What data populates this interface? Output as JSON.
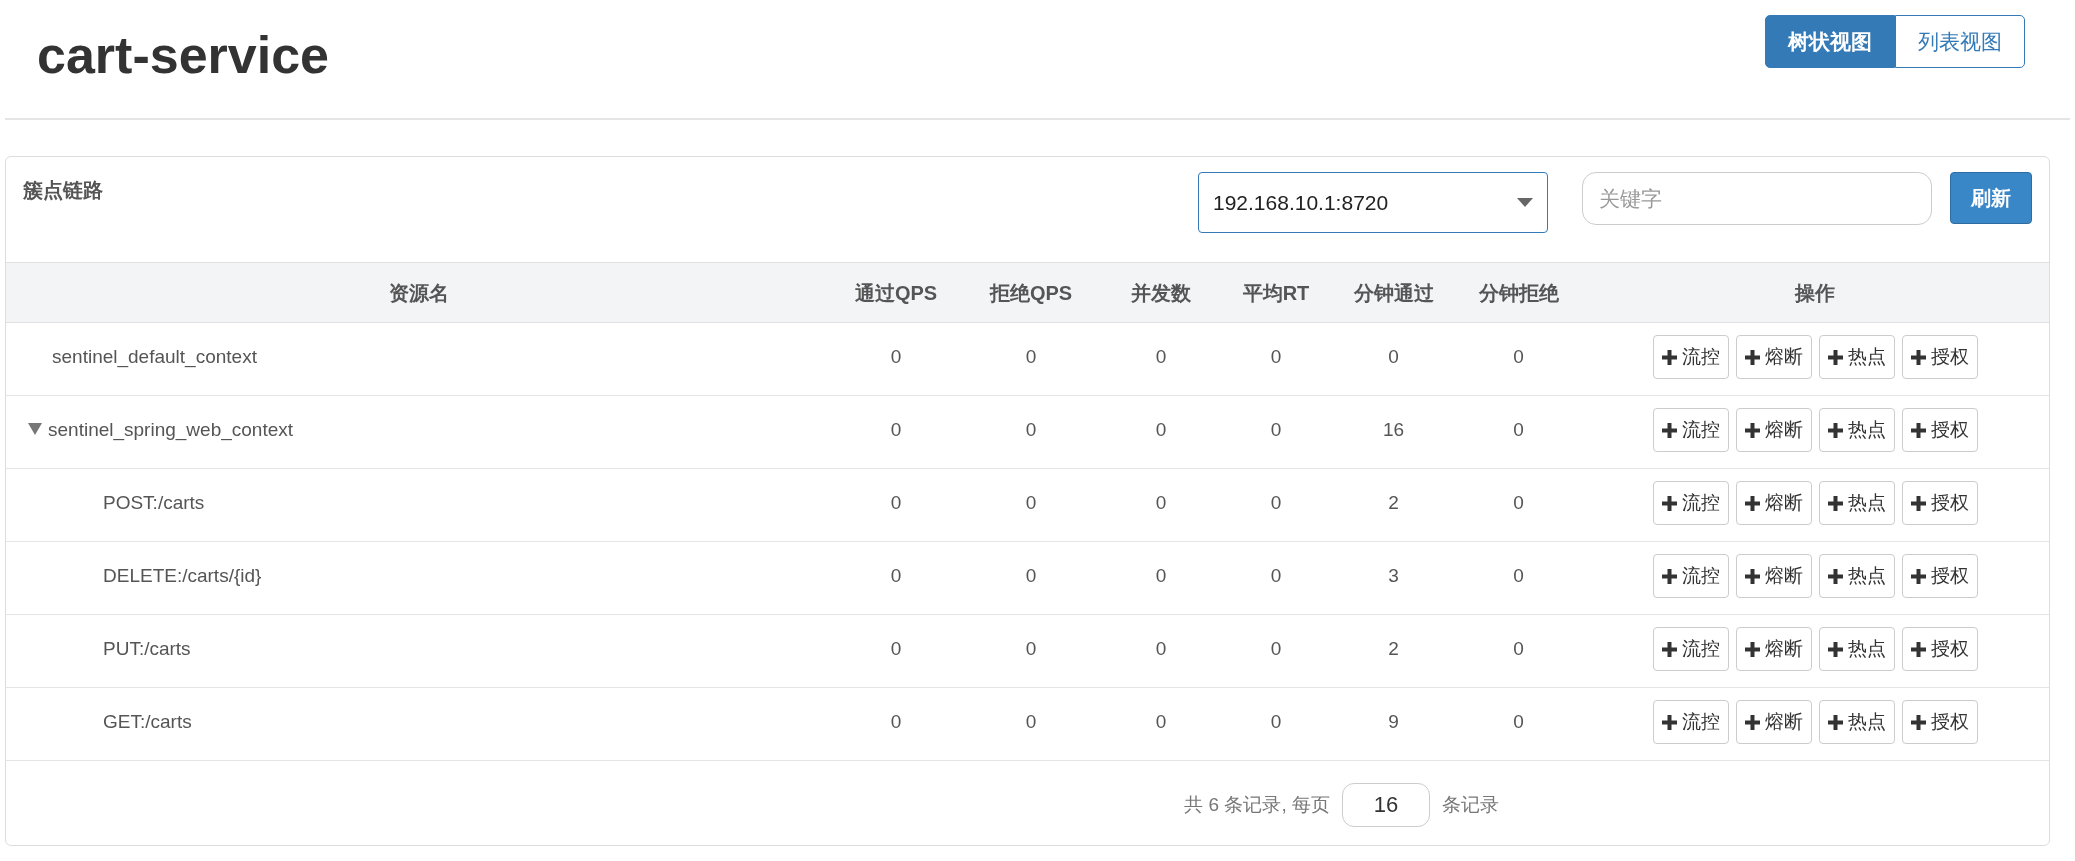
{
  "page_title": "cart-service",
  "view_toggle": [
    {
      "label": "树状视图",
      "selected": true
    },
    {
      "label": "列表视图",
      "selected": false
    }
  ],
  "panel": {
    "title": "簇点链路",
    "machine_select": {
      "value": "192.168.10.1:8720"
    },
    "search": {
      "placeholder": "关键字"
    },
    "refresh_button": "刷新"
  },
  "table": {
    "columns": [
      "资源名",
      "通过QPS",
      "拒绝QPS",
      "并发数",
      "平均RT",
      "分钟通过",
      "分钟拒绝",
      "操作"
    ],
    "rows": [
      {
        "name": "sentinel_default_context",
        "values": [
          "0",
          "0",
          "0",
          "0",
          "0",
          "0"
        ],
        "actions": [
          "流控",
          "熔断",
          "热点",
          "授权"
        ]
      },
      {
        "name": "sentinel_spring_web_context",
        "expanded": true,
        "values": [
          "0",
          "0",
          "0",
          "0",
          "16",
          "0"
        ],
        "actions": [
          "流控",
          "熔断",
          "热点",
          "授权"
        ],
        "children": [
          {
            "name": "POST:/carts",
            "values": [
              "0",
              "0",
              "0",
              "0",
              "2",
              "0"
            ],
            "actions": [
              "流控",
              "熔断",
              "热点",
              "授权"
            ]
          },
          {
            "name": "DELETE:/carts/{id}",
            "values": [
              "0",
              "0",
              "0",
              "0",
              "3",
              "0"
            ],
            "actions": [
              "流控",
              "熔断",
              "热点",
              "授权"
            ]
          },
          {
            "name": "PUT:/carts",
            "values": [
              "0",
              "0",
              "0",
              "0",
              "2",
              "0"
            ],
            "actions": [
              "流控",
              "熔断",
              "热点",
              "授权"
            ]
          },
          {
            "name": "GET:/carts",
            "values": [
              "0",
              "0",
              "0",
              "0",
              "9",
              "0"
            ],
            "actions": [
              "流控",
              "熔断",
              "热点",
              "授权"
            ]
          }
        ]
      }
    ]
  },
  "pagination": {
    "text_before": "共 6 条记录, 每页",
    "page_size": "16",
    "text_after": "条记录"
  }
}
